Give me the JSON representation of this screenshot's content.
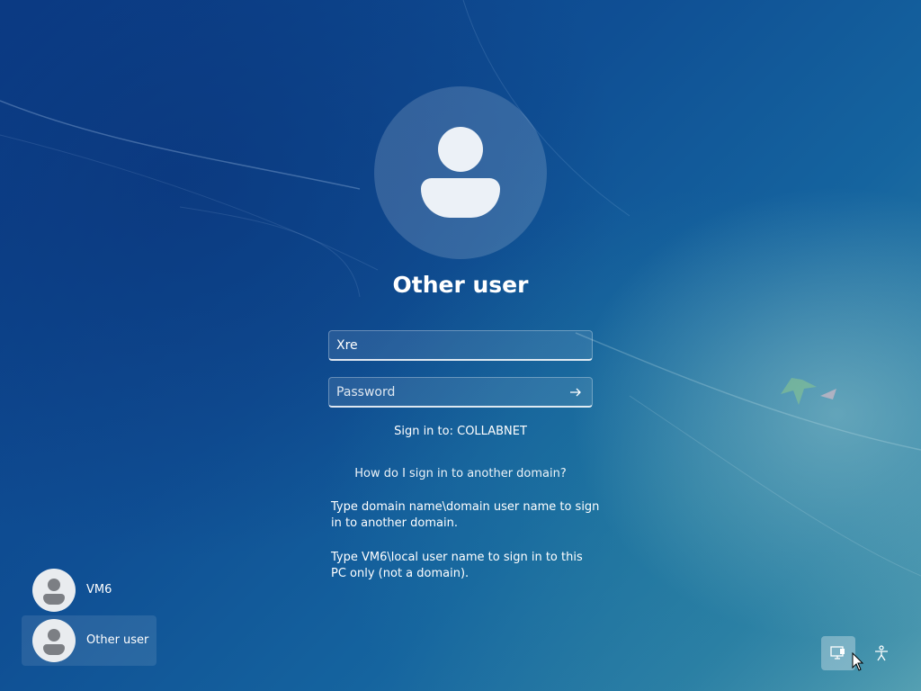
{
  "login": {
    "display_name": "Other user",
    "username_value": "Xre",
    "password_placeholder": "Password",
    "sign_in_to": "Sign in to: COLLABNET",
    "domain_help_link": "How do I sign in to another domain?",
    "help_domain": "Type domain name\\domain user name to sign in to another domain.",
    "help_local": "Type VM6\\local user name to sign in to this PC only (not a domain)."
  },
  "users": [
    {
      "label": "VM6",
      "selected": false
    },
    {
      "label": "Other user",
      "selected": true
    }
  ],
  "icons": {
    "submit": "arrow-right-icon",
    "network": "network-icon",
    "accessibility": "accessibility-icon"
  }
}
